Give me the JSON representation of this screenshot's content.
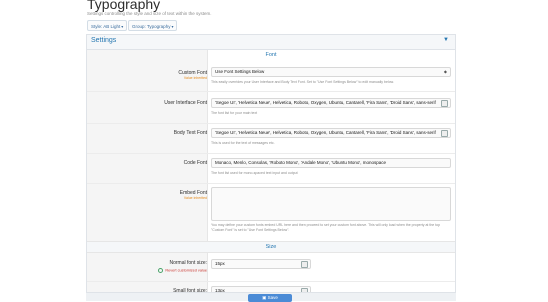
{
  "page": {
    "title": "Typography",
    "description": "Settings controlling the style and size of text within the system.",
    "chips": [
      "Style: AB Light",
      "Group: Typography"
    ]
  },
  "panel": {
    "title": "Settings",
    "sections": {
      "font": "Font",
      "size": "Size"
    }
  },
  "font": {
    "custom_font": {
      "label": "Custom Font",
      "sublabel": "Value inherited",
      "value": "Use Font Settings Below",
      "hint": "This easily overrides your User Interface and Body Text Font. Set to \"Use Font Settings Below\" to edit manually below."
    },
    "ui_font": {
      "label": "User Interface Font",
      "value": "'Segoe UI', 'Helvetica Neue', Helvetica, Roboto, Oxygen, Ubuntu, Cantarell, 'Fira Sans', 'Droid Sans', sans-serif",
      "hint": "The font list for your main text"
    },
    "body_font": {
      "label": "Body Text Font",
      "value": "'Segoe UI', 'Helvetica Neue', Helvetica, Roboto, Oxygen, Ubuntu, Cantarell, 'Fira Sans', 'Droid Sans', sans-serif",
      "hint": "This is used for the text of messages etc."
    },
    "code_font": {
      "label": "Code Font",
      "value": "Monaco, Menlo, Consolas, 'Roboto Mono', 'Andale Mono', 'Ubuntu Mono', monospace",
      "hint": "The font list used for mono-spaced text input and output"
    },
    "embed_font": {
      "label": "Embed Font",
      "sublabel": "Value inherited",
      "value": "",
      "hint": "You may define your custom fonts embed URL here and then proceed to set your custom font above. This will only load when the property at the top \"Custom Font\" is set to \"Use Font Settings Below\"."
    }
  },
  "size": {
    "normal": {
      "label": "Normal font size:",
      "value": "15px",
      "revert": "Revert customized value"
    },
    "small": {
      "label": "Small font size:",
      "value": "13px"
    }
  },
  "actions": {
    "save_label": "Save"
  }
}
